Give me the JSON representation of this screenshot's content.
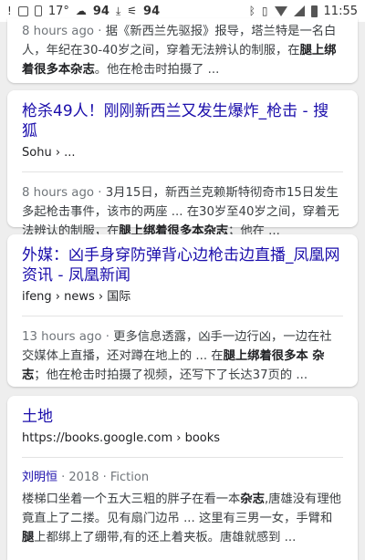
{
  "status_bar": {
    "temperature": "17°",
    "percent_left": "94",
    "percent_right": "94",
    "time": "11:55"
  },
  "results": [
    {
      "snippet": {
        "meta": "8 hours ago · ",
        "t1": "据《新西兰先驱报》报导，塔兰特是一名白人，年纪在30-40岁之间，穿着无法辨认的制服，在",
        "bold1": "腿上绑着很多本杂志",
        "t2": "。他在枪击时拍摄了 ..."
      }
    },
    {
      "title": "枪杀49人！刚刚新西兰又发生爆炸_枪击 - 搜狐",
      "url": "Sohu ›",
      "url_suffix": " ...",
      "snippet": {
        "meta": "8 hours ago · ",
        "t1": "3月15日，新西兰克赖斯特彻奇市15日发生多起枪击事件，该市的两座 ... 在30岁至40岁之间，穿着无法辨认的制服，在",
        "bold1": "腿上绑着很多本杂志",
        "t2": "；他在 ..."
      }
    },
    {
      "title": "外媒：凶手身穿防弹背心边枪击边直播_凤凰网资讯 - 凤凰新闻",
      "url": "ifeng › news › 国际",
      "snippet": {
        "meta": "13 hours ago · ",
        "t1": "更多信息透露，凶手一边行凶，一边在社交媒体上直播，还对蹲在地上的 ... 在",
        "bold1": "腿上绑着很多本 杂志",
        "t2": "；他在枪击时拍摄了视频，还写下了长达37页的 ..."
      }
    },
    {
      "title": "土地",
      "url": "https://books.google.com › books",
      "author": "刘明恒",
      "author_meta": " · 2018 · Fiction",
      "snippet": {
        "t1": "楼梯口坐着一个五大三粗的胖子在看一本",
        "bold1": "杂志",
        "t2": ",唐雄没有理他竟直上了二搂。见有扇门边吊 ... 这里有三男一女，手臂和",
        "bold2": "腿",
        "t3": "上都绑上了绷带,有的还上着夹板。唐雄就感到 ..."
      }
    }
  ],
  "colors": {
    "background": "#eeeeee",
    "card": "#ffffff",
    "link": "#1a0dab",
    "meta": "#70757a",
    "text": "#3c4043"
  }
}
